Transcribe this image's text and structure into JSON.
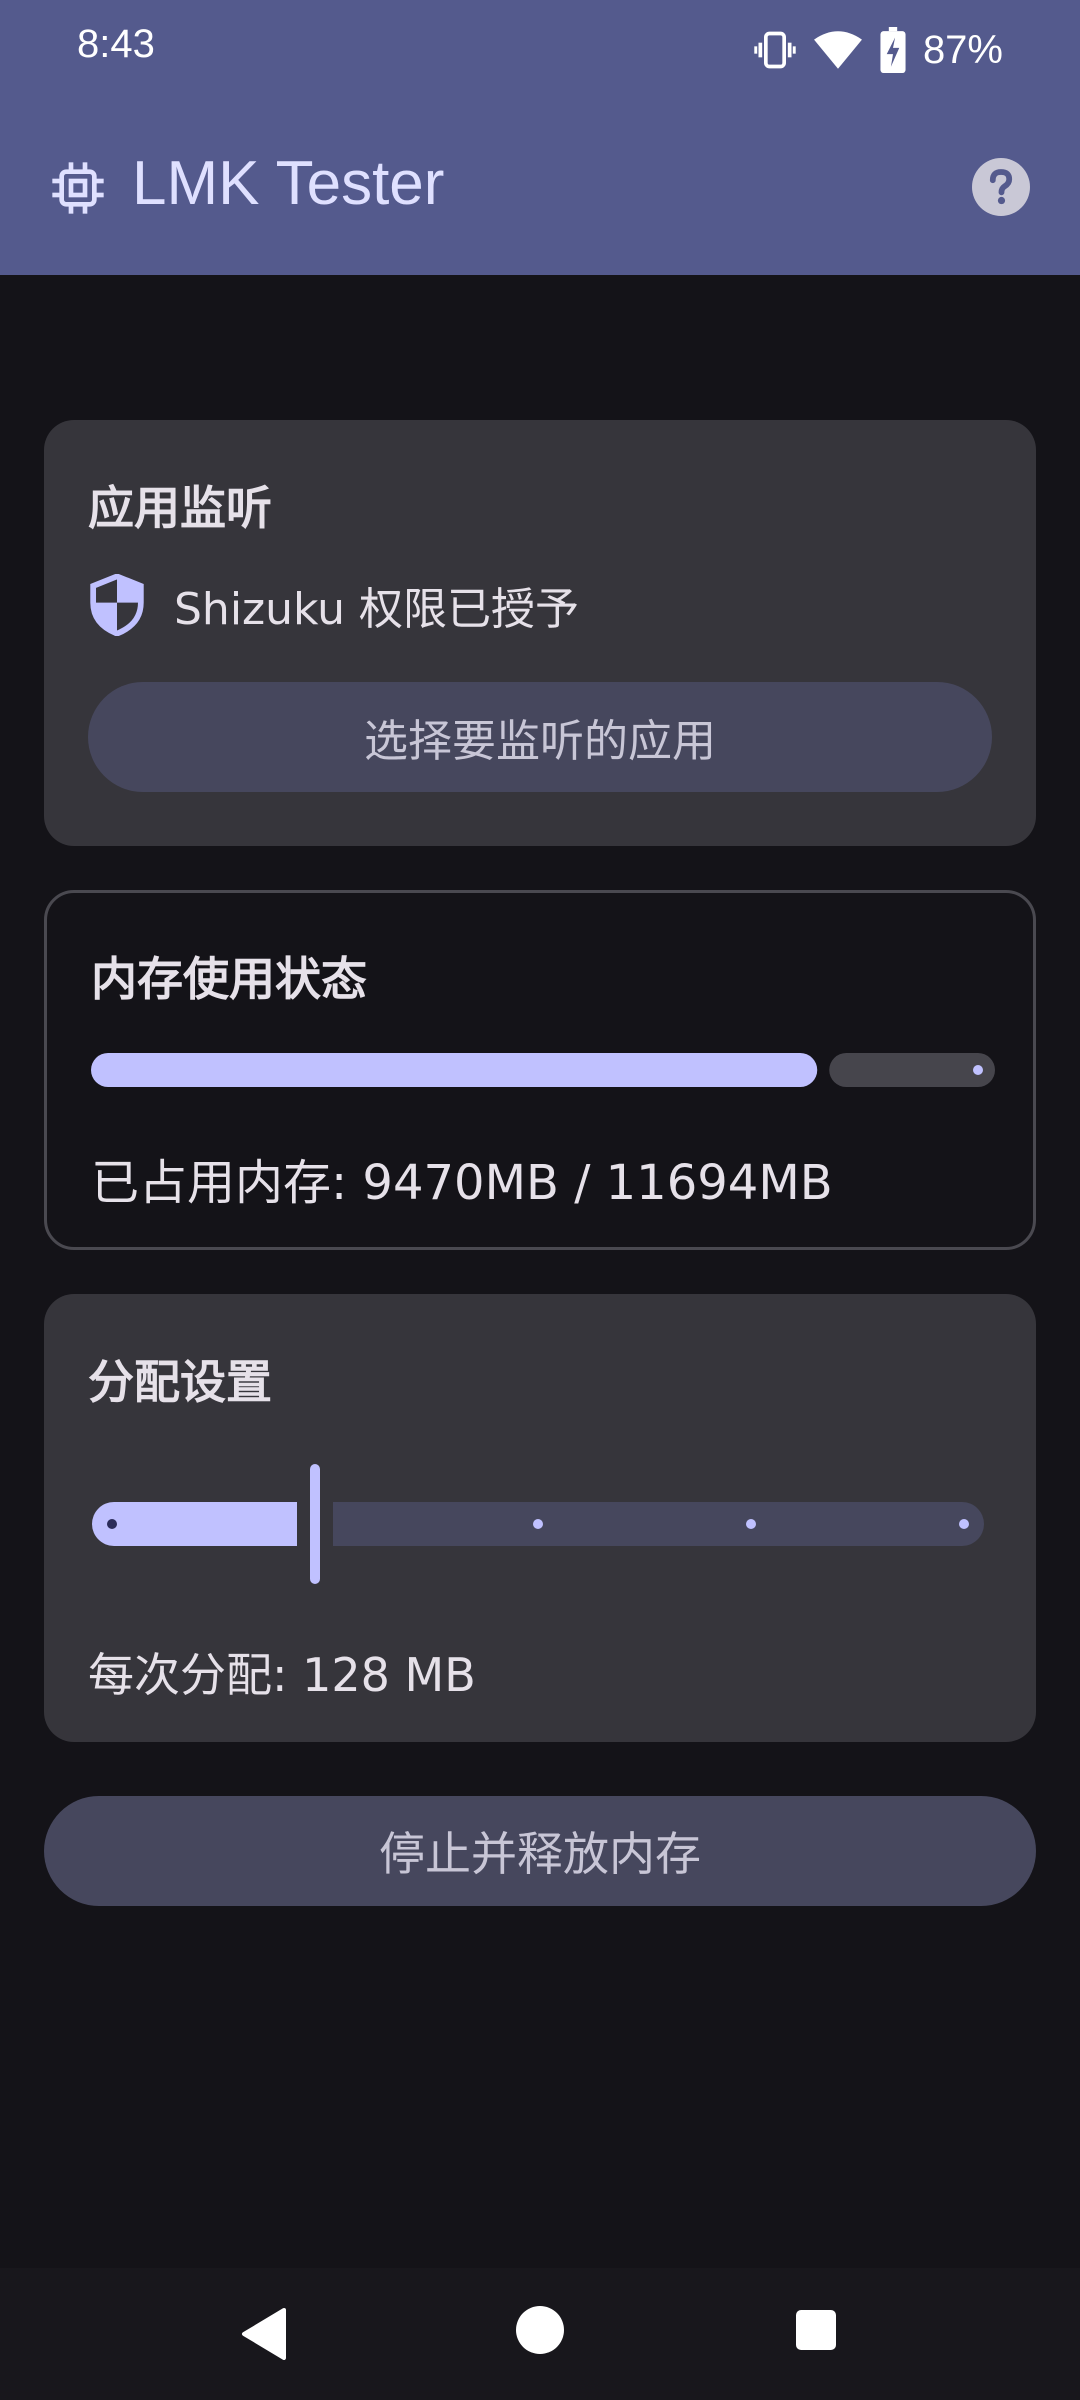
{
  "status_bar": {
    "time": "8:43",
    "battery_percent": "87%",
    "icons": [
      "vibrate-icon",
      "wifi-icon",
      "battery-charging-icon"
    ]
  },
  "app_bar": {
    "title": "LMK Tester",
    "leading_icon": "chip-icon",
    "trailing_icon": "help-icon"
  },
  "monitor_card": {
    "title": "应用监听",
    "permission_text": "Shizuku 权限已授予",
    "select_app_button": "选择要监听的应用"
  },
  "memory_card": {
    "title": "内存使用状态",
    "usage_text": "已占用内存: 9470MB / 11694MB",
    "usage_fraction": 0.81
  },
  "allocation_card": {
    "title": "分配设置",
    "per_allocation_text": "每次分配: 128 MB",
    "slider_value_fraction": 0.25,
    "slider_steps": 5
  },
  "stop_button": {
    "label": "停止并释放内存"
  },
  "colors": {
    "top_bar": "#545a8d",
    "accent": "#c0c1ff",
    "background": "#141318",
    "card": "#36353b",
    "button": "#46475d"
  }
}
